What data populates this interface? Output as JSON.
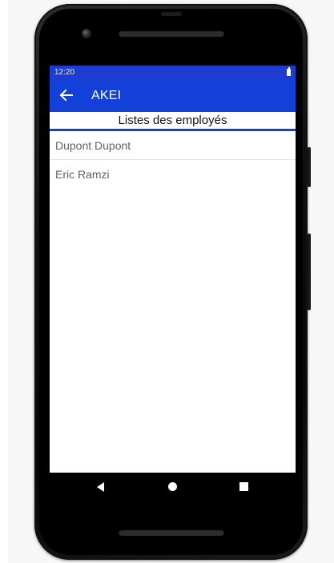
{
  "status_bar": {
    "time": "12:20",
    "battery_icon": "battery-full-icon"
  },
  "app_bar": {
    "back_icon": "arrow-left-icon",
    "title": "AKEI"
  },
  "list": {
    "header": "Listes des employés",
    "items": [
      {
        "label": "Dupont Dupont"
      },
      {
        "label": "Eric Ramzi"
      }
    ]
  },
  "nav_bar": {
    "back_icon": "nav-back-triangle-icon",
    "home_icon": "nav-home-circle-icon",
    "recents_icon": "nav-recents-square-icon"
  },
  "colors": {
    "status_bar": "#1e3ccf",
    "app_bar": "#1340d9",
    "header_underline": "#1340d9",
    "list_text": "#616161",
    "screen_background": "#ffffff",
    "nav_bar": "#000000"
  }
}
